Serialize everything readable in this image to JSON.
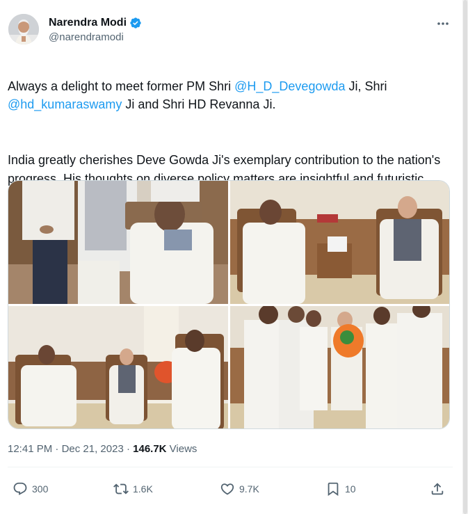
{
  "author": {
    "display_name": "Narendra Modi",
    "handle": "@narendramodi",
    "verified": true,
    "avatar_icon": "user-avatar-photo"
  },
  "tweet": {
    "p1_a": "Always a delight to meet former PM Shri ",
    "p1_mention1": "@H_D_Devegowda",
    "p1_b": " Ji, Shri ",
    "p1_mention2": "@hd_kumaraswamy",
    "p1_c": " Ji and Shri HD Revanna Ji.",
    "p2": "India greatly cherishes Deve Gowda Ji's exemplary contribution to the nation's progress. His thoughts on diverse policy matters are insightful and futuristic."
  },
  "meta": {
    "time": "12:41 PM",
    "separator1": " · ",
    "date": "Dec 21, 2023",
    "separator2": " · ",
    "views_count": "146.7K",
    "views_label": " Views"
  },
  "actions": {
    "replies": "300",
    "reposts": "1.6K",
    "likes": "9.7K",
    "bookmarks": "10"
  },
  "colors": {
    "accent": "#1d9bf0",
    "text": "#0f1419",
    "secondary": "#536471"
  }
}
